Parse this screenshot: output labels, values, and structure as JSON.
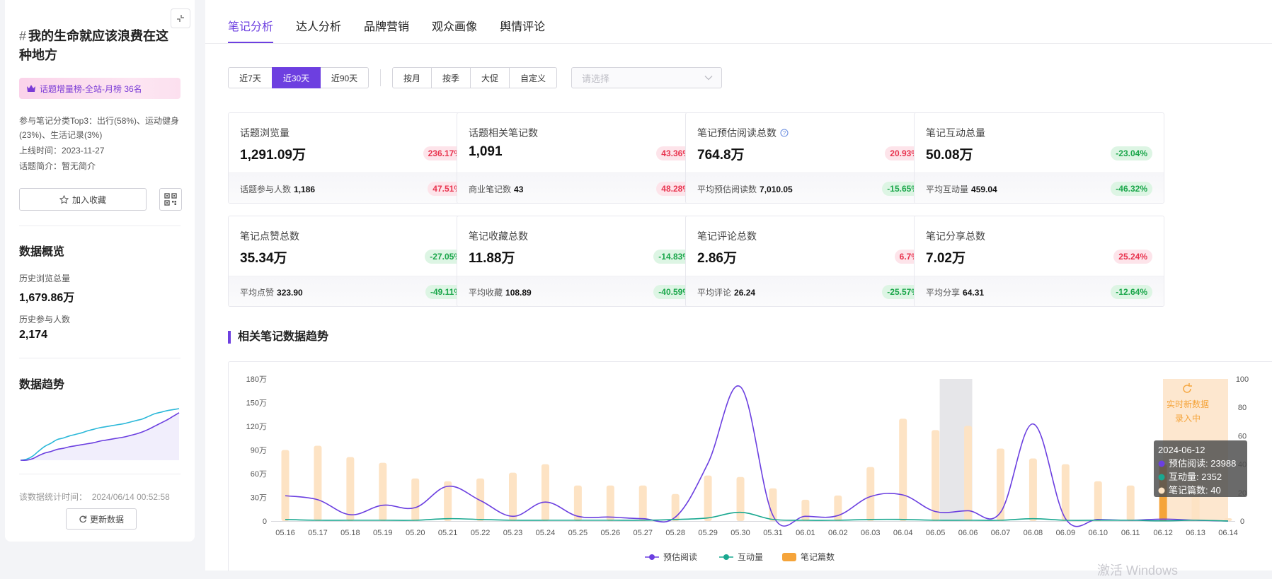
{
  "topic": {
    "hash": "#",
    "title": "我的生命就应该浪费在这种地方",
    "rank_badge": "话题增量榜-全站-月榜 36名",
    "categories": "参与笔记分类Top3：出行(58%)、运动健身(23%)、生活记录(3%)",
    "online_label": "上线时间：",
    "online_value": "2023-11-27",
    "intro_label": "话题简介：",
    "intro_value": "暂无简介",
    "fav_label": "加入收藏"
  },
  "overview": {
    "title": "数据概览",
    "history_views_label": "历史浏览总量",
    "history_views_value": "1,679.86万",
    "history_users_label": "历史参与人数",
    "history_users_value": "2,174"
  },
  "trend_side": {
    "title": "数据趋势",
    "stat_time_label": "该数据统计时间：",
    "stat_time_value": "2024/06/14 00:52:58",
    "refresh_label": "更新数据"
  },
  "tabs": [
    "笔记分析",
    "达人分析",
    "品牌营销",
    "观众画像",
    "舆情评论"
  ],
  "active_tab": 0,
  "range_buttons": [
    "近7天",
    "近30天",
    "近90天"
  ],
  "active_range": 1,
  "period_buttons": [
    "按月",
    "按季",
    "大促",
    "自定义"
  ],
  "select_placeholder": "请选择",
  "cards": [
    {
      "label": "话题浏览量",
      "value": "1,291.09万",
      "change": "236.17%",
      "dir": "up",
      "sub_label": "话题参与人数",
      "sub_value": "1,186",
      "sub_change": "47.51%",
      "sub_dir": "up",
      "info": false
    },
    {
      "label": "话题相关笔记数",
      "value": "1,091",
      "change": "43.36%",
      "dir": "up",
      "sub_label": "商业笔记数",
      "sub_value": "43",
      "sub_change": "48.28%",
      "sub_dir": "up",
      "info": false
    },
    {
      "label": "笔记预估阅读总数",
      "value": "764.8万",
      "change": "20.93%",
      "dir": "up",
      "sub_label": "平均预估阅读数",
      "sub_value": "7,010.05",
      "sub_change": "-15.65%",
      "sub_dir": "down",
      "info": true
    },
    {
      "label": "笔记互动总量",
      "value": "50.08万",
      "change": "-23.04%",
      "dir": "down",
      "sub_label": "平均互动量",
      "sub_value": "459.04",
      "sub_change": "-46.32%",
      "sub_dir": "down",
      "info": false
    },
    {
      "label": "笔记点赞总数",
      "value": "35.34万",
      "change": "-27.05%",
      "dir": "down",
      "sub_label": "平均点赞",
      "sub_value": "323.90",
      "sub_change": "-49.11%",
      "sub_dir": "down",
      "info": false
    },
    {
      "label": "笔记收藏总数",
      "value": "11.88万",
      "change": "-14.83%",
      "dir": "down",
      "sub_label": "平均收藏",
      "sub_value": "108.89",
      "sub_change": "-40.59%",
      "sub_dir": "down",
      "info": false
    },
    {
      "label": "笔记评论总数",
      "value": "2.86万",
      "change": "6.7%",
      "dir": "up",
      "sub_label": "平均评论",
      "sub_value": "26.24",
      "sub_change": "-25.57%",
      "sub_dir": "down",
      "info": false
    },
    {
      "label": "笔记分享总数",
      "value": "7.02万",
      "change": "25.24%",
      "dir": "up",
      "sub_label": "平均分享",
      "sub_value": "64.31",
      "sub_change": "-12.64%",
      "sub_dir": "down",
      "info": false
    }
  ],
  "trend_title": "相关笔记数据趋势",
  "colors": {
    "accent": "#6d3fe0",
    "read_line": "#6b3fe0",
    "interact_line": "#1aa890",
    "bar": "#fde3c4",
    "bar_highlight": "#f5a43a",
    "up": "#e8344f",
    "down": "#1aa64a"
  },
  "chart_data": {
    "type": "bar",
    "categories": [
      "05.16",
      "05.17",
      "05.18",
      "05.19",
      "05.20",
      "05.21",
      "05.22",
      "05.23",
      "05.24",
      "05.25",
      "05.26",
      "05.27",
      "05.28",
      "05.29",
      "05.30",
      "05.31",
      "06.01",
      "06.02",
      "06.03",
      "06.04",
      "06.05",
      "06.06",
      "06.07",
      "06.08",
      "06.09",
      "06.10",
      "06.11",
      "06.12",
      "06.13",
      "06.14"
    ],
    "left_ticks": [
      "0",
      "30万",
      "60万",
      "90万",
      "120万",
      "150万",
      "180万"
    ],
    "left_max": 1800000,
    "right_ticks": [
      "0",
      "20",
      "40",
      "60",
      "80",
      "100"
    ],
    "right_max": 100,
    "series": [
      {
        "name": "预估阅读",
        "type": "line",
        "axis": "left",
        "values": [
          320000,
          270000,
          80000,
          200000,
          170000,
          440000,
          260000,
          60000,
          240000,
          60000,
          50000,
          30000,
          50000,
          730000,
          1700000,
          70000,
          60000,
          70000,
          310000,
          330000,
          120000,
          130000,
          110000,
          1230000,
          30000,
          20000,
          10000,
          23988,
          10000,
          0
        ]
      },
      {
        "name": "互动量",
        "type": "line",
        "axis": "left",
        "values": [
          20000,
          10000,
          10000,
          10000,
          10000,
          30000,
          20000,
          10000,
          10000,
          10000,
          10000,
          10000,
          20000,
          40000,
          110000,
          20000,
          10000,
          10000,
          20000,
          20000,
          10000,
          10000,
          10000,
          30000,
          10000,
          10000,
          10000,
          2352,
          10000,
          0
        ]
      },
      {
        "name": "笔记篇数",
        "type": "bar",
        "axis": "right",
        "values": [
          50,
          53,
          45,
          41,
          30,
          28,
          30,
          34,
          40,
          25,
          25,
          25,
          19,
          32,
          31,
          23,
          15,
          18,
          38,
          72,
          64,
          67,
          51,
          44,
          40,
          28,
          25,
          40,
          28,
          2
        ]
      }
    ],
    "highlight_category": "06.06",
    "realtime_category": "06.14",
    "realtime_label": "实时新数据录入中",
    "tooltip": {
      "date": "2024-06-12",
      "rows": [
        {
          "name": "预估阅读",
          "value": "23988"
        },
        {
          "name": "互动量",
          "value": "2352"
        },
        {
          "name": "笔记篇数",
          "value": "40"
        }
      ]
    },
    "legend": [
      "预估阅读",
      "互动量",
      "笔记篇数"
    ],
    "legend_position": "bottom-center"
  },
  "spark_data": {
    "series": [
      {
        "name": "top",
        "values": [
          0,
          2,
          8,
          18,
          27,
          33,
          40,
          43,
          47,
          50,
          53,
          57,
          60,
          63,
          65,
          67,
          69,
          71,
          74,
          77,
          80,
          85,
          90,
          93,
          96,
          98,
          100
        ]
      },
      {
        "name": "bottom",
        "values": [
          0,
          0,
          3,
          9,
          14,
          17,
          21,
          23,
          26,
          28,
          30,
          32,
          34,
          37,
          39,
          41,
          43,
          45,
          48,
          51,
          55,
          60,
          66,
          72,
          78,
          85,
          92
        ]
      }
    ]
  },
  "watermark": "激活 Windows"
}
